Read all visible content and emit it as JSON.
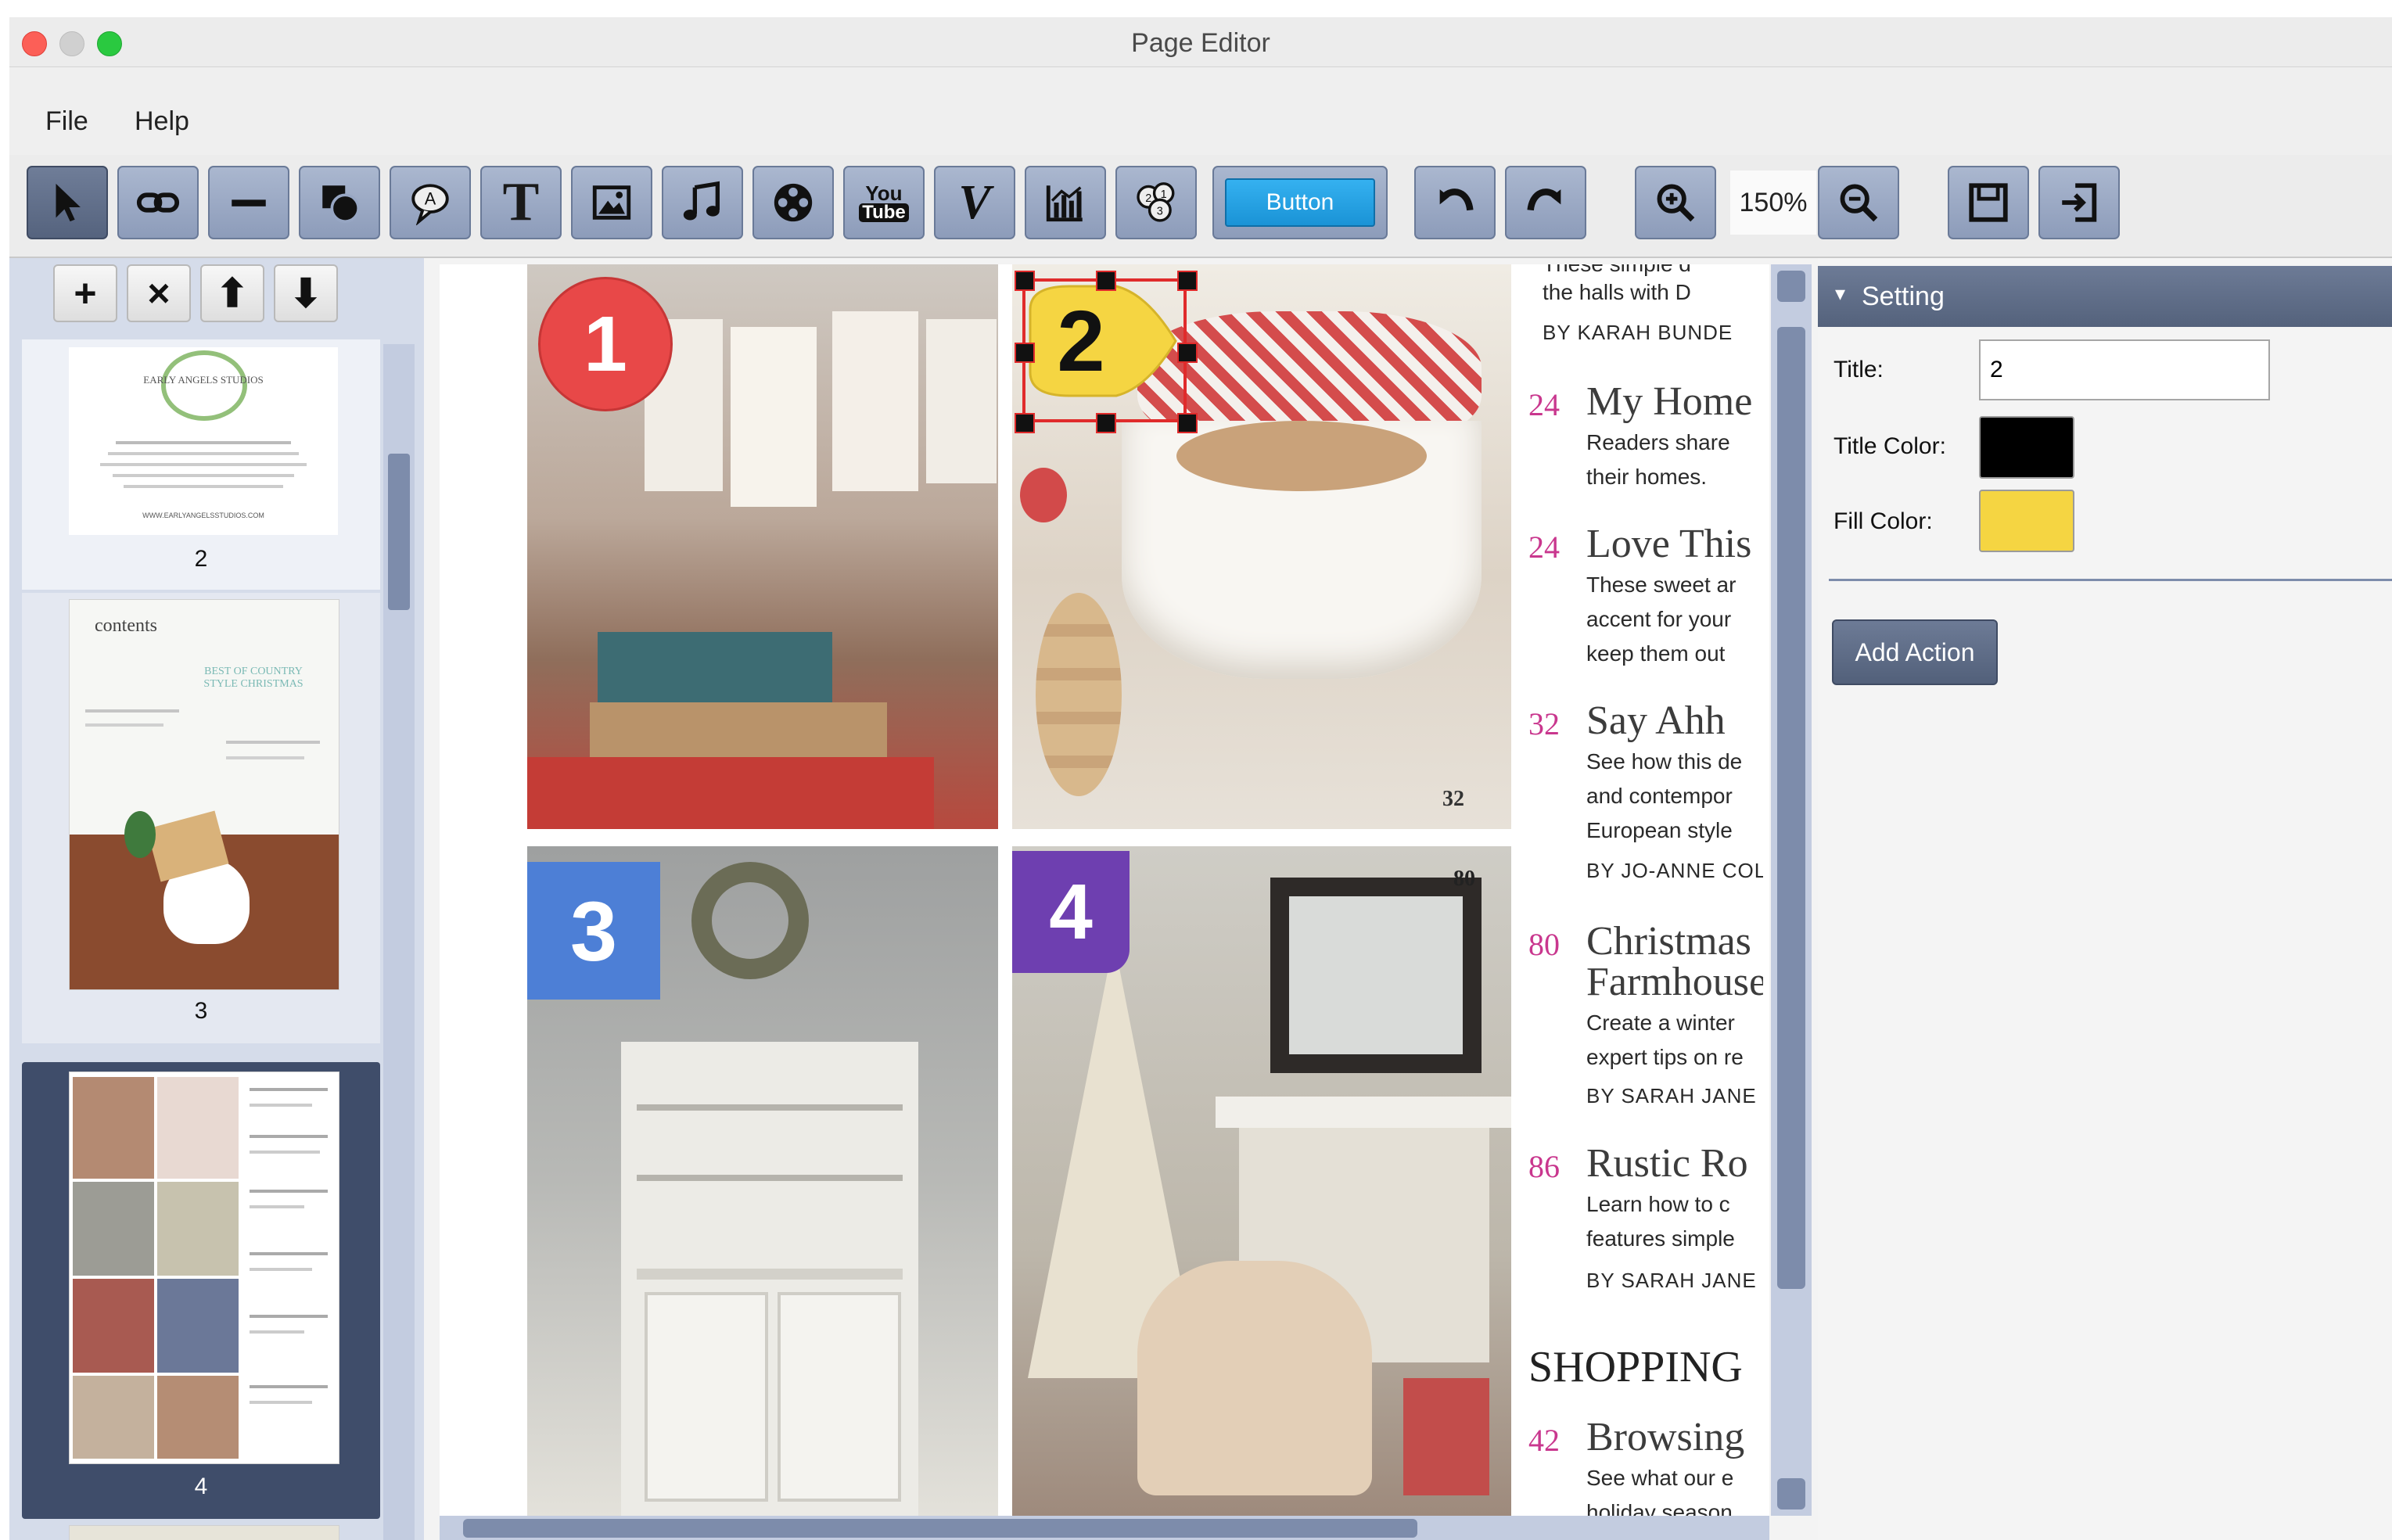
{
  "window": {
    "title": "Page Editor"
  },
  "menu": {
    "items": [
      "File",
      "Help"
    ]
  },
  "toolbar": {
    "tools": [
      {
        "icon": "select-arrow-icon",
        "active": true
      },
      {
        "icon": "link-icon"
      },
      {
        "icon": "line-icon"
      },
      {
        "icon": "shapes-icon"
      },
      {
        "icon": "speech-bubble-icon"
      },
      {
        "icon": "text-icon",
        "glyph": "T"
      },
      {
        "icon": "image-icon"
      },
      {
        "icon": "music-note-icon"
      },
      {
        "icon": "film-reel-icon"
      },
      {
        "icon": "youtube-icon",
        "line1": "You",
        "line2": "Tube"
      },
      {
        "icon": "vimeo-icon",
        "glyph": "V"
      },
      {
        "icon": "chart-icon"
      },
      {
        "icon": "numbered-markers-icon"
      }
    ],
    "button_widget_label": "Button",
    "zoom_level": "150%"
  },
  "pages_panel": {
    "actions": [
      "+",
      "×",
      "⬆",
      "⬇"
    ],
    "thumbnails": [
      {
        "number": "2",
        "heading": "EARLY ANGELS STUDIOS",
        "footer": "WWW.EARLYANGELSSTUDIOS.COM",
        "selected": false
      },
      {
        "number": "3",
        "heading": "contents",
        "subtitle": "BEST OF COUNTRY STYLE CHRISTMAS",
        "selected": false
      },
      {
        "number": "4",
        "selected": true
      }
    ]
  },
  "canvas": {
    "markers": [
      {
        "label": "1",
        "shape": "circle",
        "color": "#e84848"
      },
      {
        "label": "2",
        "shape": "pin",
        "color": "#f5d542",
        "selected": true
      },
      {
        "label": "3",
        "shape": "square",
        "color": "#4d7fd6"
      },
      {
        "label": "4",
        "shape": "rounded-square",
        "color": "#6e3fb0"
      }
    ],
    "photo_page_numbers": [
      "32",
      "80"
    ],
    "contents": [
      {
        "line": "These simple d",
        "kind": "text"
      },
      {
        "line": "the halls with D",
        "kind": "text"
      },
      {
        "line": "BY KARAH BUNDE",
        "kind": "by"
      },
      {
        "num": "24",
        "title": "My Home",
        "lines": [
          "Readers share",
          "their homes."
        ]
      },
      {
        "num": "24",
        "title": "Love This",
        "lines": [
          "These sweet ar",
          "accent for your",
          "keep them out"
        ]
      },
      {
        "num": "32",
        "title": "Say Ahh",
        "lines": [
          "See how this de",
          "and contempor",
          "European style"
        ],
        "by": "BY JO-ANNE COL"
      },
      {
        "num": "80",
        "title": "Christmas",
        "title2": "Farmhouse",
        "lines": [
          "Create a winter",
          "expert tips on re"
        ],
        "by": "BY SARAH JANE"
      },
      {
        "num": "86",
        "title": "Rustic Ro",
        "lines": [
          "Learn how to c",
          "features simple"
        ],
        "by": "BY SARAH JANE"
      },
      {
        "section": "SHOPPING"
      },
      {
        "num": "42",
        "title": "Browsing",
        "lines": [
          "See what our e",
          "holiday season"
        ]
      }
    ]
  },
  "settings": {
    "header": "Setting",
    "title_label": "Title:",
    "title_value": "2",
    "title_color_label": "Title Color:",
    "title_color": "#000000",
    "fill_color_label": "Fill Color:",
    "fill_color": "#f5d542",
    "add_action_label": "Add Action"
  }
}
